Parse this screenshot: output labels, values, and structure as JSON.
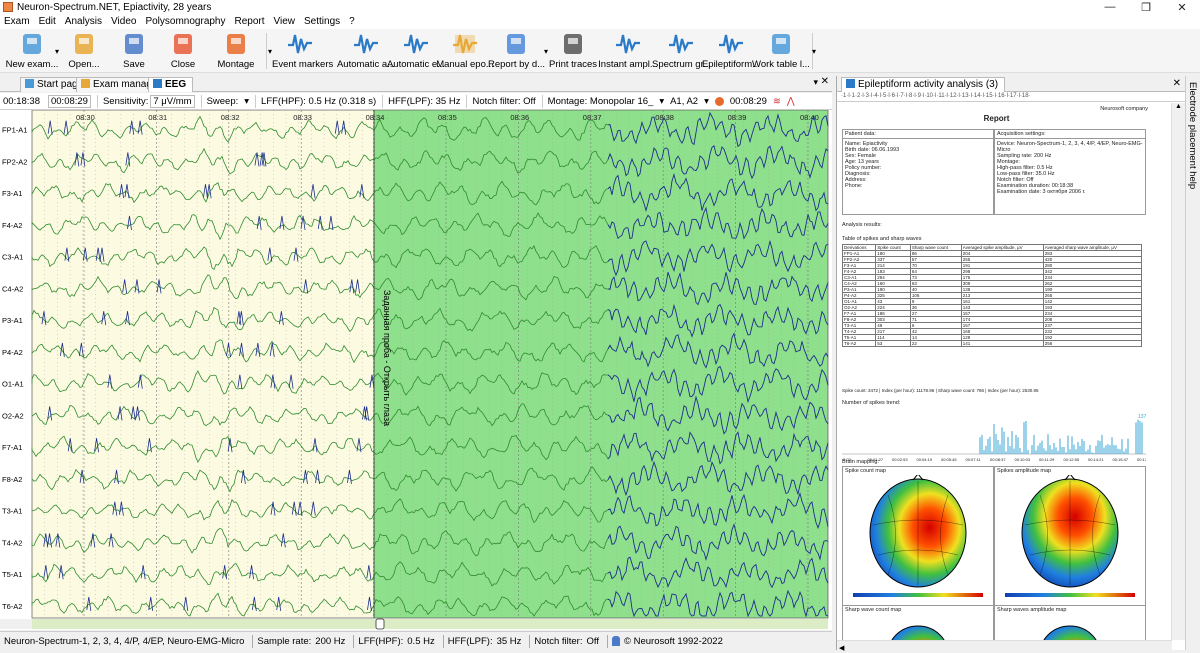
{
  "window": {
    "title": "Neuron-Spectrum.NET, Epiactivity, 28 years",
    "minimize": "—",
    "maximize": "❐",
    "close": "✕"
  },
  "menu": [
    "Exam",
    "Edit",
    "Analysis",
    "Video",
    "Polysomnography",
    "Report",
    "View",
    "Settings",
    "?"
  ],
  "toolbar": {
    "buttons": [
      {
        "label": "New exam...",
        "icon": "new-exam-icon",
        "color": "#4a9ad8"
      },
      {
        "label": "Open...",
        "icon": "open-icon",
        "color": "#e8a838"
      },
      {
        "label": "Save",
        "icon": "save-icon",
        "color": "#4a7ac8"
      },
      {
        "label": "Close",
        "icon": "close-exam-icon",
        "color": "#e85a3a"
      },
      {
        "label": "Montage",
        "icon": "montage-icon",
        "color": "#e86a2a"
      },
      {
        "label": "Event markers",
        "icon": "event-markers-icon",
        "color": "#2a7ac8"
      },
      {
        "label": "Automatic a...",
        "icon": "automatic-analysis-icon",
        "color": "#2a7ac8"
      },
      {
        "label": "Automatic e...",
        "icon": "automatic-epoch-icon",
        "color": "#2a7ac8"
      },
      {
        "label": "Manual epo...",
        "icon": "manual-epoch-icon",
        "color": "#e8a838"
      },
      {
        "label": "Report by d...",
        "icon": "report-icon",
        "color": "#4a8ad8"
      },
      {
        "label": "Print traces",
        "icon": "print-icon",
        "color": "#555555"
      },
      {
        "label": "Instant ampl...",
        "icon": "instant-amplitude-icon",
        "color": "#2a7ac8"
      },
      {
        "label": "Spectrum gr...",
        "icon": "spectrum-icon",
        "color": "#2a7ac8"
      },
      {
        "label": "Epileptiform...",
        "icon": "epileptiform-icon",
        "color": "#2a7ac8"
      },
      {
        "label": "Work table l...",
        "icon": "work-table-icon",
        "color": "#4a9ad8"
      }
    ]
  },
  "tabs": {
    "start": "Start page",
    "manager": "Exam manager",
    "eeg": "EEG"
  },
  "eeg_toolbar": {
    "time": "00:18:38",
    "duration": "00:08:29",
    "sensitivity": "Sensitivity:",
    "sensitivity_value": "7 μV/mm",
    "sweep": "Sweep:",
    "lff": "LFF(HPF):",
    "lff_value": "0.5 Hz (0.318 s)",
    "hff": "HFF(LPF):",
    "hff_value": "35 Hz",
    "notch": "Notch filter:",
    "notch_value": "Off",
    "montage": "Montage:",
    "montage_value": "Monopolar 16_",
    "ref": "A1, A2",
    "video_time": "00:08:29"
  },
  "eeg": {
    "channels": [
      "FP1-A1",
      "FP2-A2",
      "F3-A1",
      "F4-A2",
      "C3-A1",
      "C4-A2",
      "P3-A1",
      "P4-A2",
      "O1-A1",
      "O2-A2",
      "F7-A1",
      "F8-A2",
      "T3-A1",
      "T4-A2",
      "T5-A1",
      "T6-A2"
    ],
    "time_marks": [
      "08:30",
      "08:31",
      "08:32",
      "08:33",
      "08:34",
      "08:35",
      "08:36",
      "08:37",
      "08:38",
      "08:39",
      "08:40"
    ],
    "event_label": "Заданная проба - Открыть глаза",
    "colors": {
      "yellow_bg": "#fcfbe2",
      "green_bg": "#8fe08c",
      "trace_green": "#2e8b2e",
      "trace_blue": "#1c2f8c"
    }
  },
  "status": {
    "device": "Neuron-Spectrum-1, 2, 3, 4, 4/P, 4/EP, Neuro-EMG-Micro",
    "rate": "Sample rate:",
    "rate_value": "200 Hz",
    "lff": "LFF(HPF):",
    "lff_value": "0.5 Hz",
    "hff": "HFF(LPF):",
    "hff_value": "35 Hz",
    "notch": "Notch filter:",
    "notch_value": "Off",
    "copyright": "© Neurosoft 1992-2022"
  },
  "right_panel": {
    "tab": "Epileptiform activity analysis (3)",
    "ruler": "·1·l·1·2·l·3·l·4·l·5·l·6·l·7·l·8·l·9·l·10·l·11·l·12·l·13·l·14·l·15·l·16·l·17·l·18·",
    "company": "Neurosoft company",
    "report_title": "Report",
    "patient_header": "Patient data:",
    "patient": [
      "Name: Epiactivity",
      "Birth date: 06.06.1993",
      "Sex: Female",
      "Age: 13 years",
      "Policy number:",
      "Diagnosis:",
      "Address:",
      "Phone:"
    ],
    "acq_header": "Acquisition settings:",
    "acq": [
      "Device: Neuron-Spectrum-1, 2, 3, 4, 4/P, 4/EP, Neuro-EMG-",
      "Micro",
      "Sampling rate: 200 Hz",
      "Montage:",
      "High-pass filter: 0.5 Hz",
      "Low-pass filter: 35.0 Hz",
      "Notch filter: Off",
      "Examination duration: 00:18:38",
      "Examination date: 3 октября 2006 г."
    ],
    "analysis_results": "Analysis results:",
    "table_title": "Table of spikes and sharp waves",
    "table_head": [
      "Derivations",
      "Spike count",
      "Sharp wave count",
      "Averaged spike amplitude, μV",
      "Averaged sharp wave amplitude, μV"
    ],
    "table_rows": [
      [
        "FP1-A1",
        "180",
        "86",
        "204",
        "283"
      ],
      [
        "FP2-A2",
        "337",
        "57",
        "255",
        "420"
      ],
      [
        "F3-A1",
        "214",
        "70",
        "191",
        "280"
      ],
      [
        "F4-A2",
        "183",
        "64",
        "298",
        "342"
      ],
      [
        "C3-A1",
        "294",
        "73",
        "175",
        "234"
      ],
      [
        "C4-A2",
        "160",
        "63",
        "309",
        "262"
      ],
      [
        "P3-A1",
        "190",
        "40",
        "138",
        "190"
      ],
      [
        "P4-A2",
        "325",
        "106",
        "213",
        "265"
      ],
      [
        "O1-A1",
        "43",
        "9",
        "161",
        "142"
      ],
      [
        "O2-A2",
        "224",
        "36",
        "143",
        "193"
      ],
      [
        "F7-A1",
        "186",
        "27",
        "157",
        "234"
      ],
      [
        "F8-A2",
        "303",
        "71",
        "174",
        "208"
      ],
      [
        "T3-A1",
        "49",
        "6",
        "157",
        "237"
      ],
      [
        "T4-A2",
        "217",
        "42",
        "168",
        "232"
      ],
      [
        "T5-A1",
        "114",
        "14",
        "129",
        "192"
      ],
      [
        "T6-A2",
        "53",
        "22",
        "141",
        "256"
      ]
    ],
    "table_summary": "Spike count: 3472 | Index (per hour): 11178.96 | Sharp wave count: 786 | Index (per hour): 2530.95",
    "trend_title": "Number of spikes trend:",
    "trend_peak": "137",
    "trend_axis": [
      "0:03",
      "00:01:27",
      "00:02:53",
      "00:04:19",
      "00:05:45",
      "00:07:11",
      "00:08:37",
      "00:10:03",
      "00:11:29",
      "00:12:55",
      "00:14:21",
      "00:15:47",
      "00:17:13"
    ],
    "brain_mapping": "Brain mapping:",
    "maps": [
      "Spike count map",
      "Spikes amplitude map",
      "Sharp wave count map",
      "Sharp waves amplitude map"
    ]
  },
  "vertical_tab": "Electrode placement help"
}
